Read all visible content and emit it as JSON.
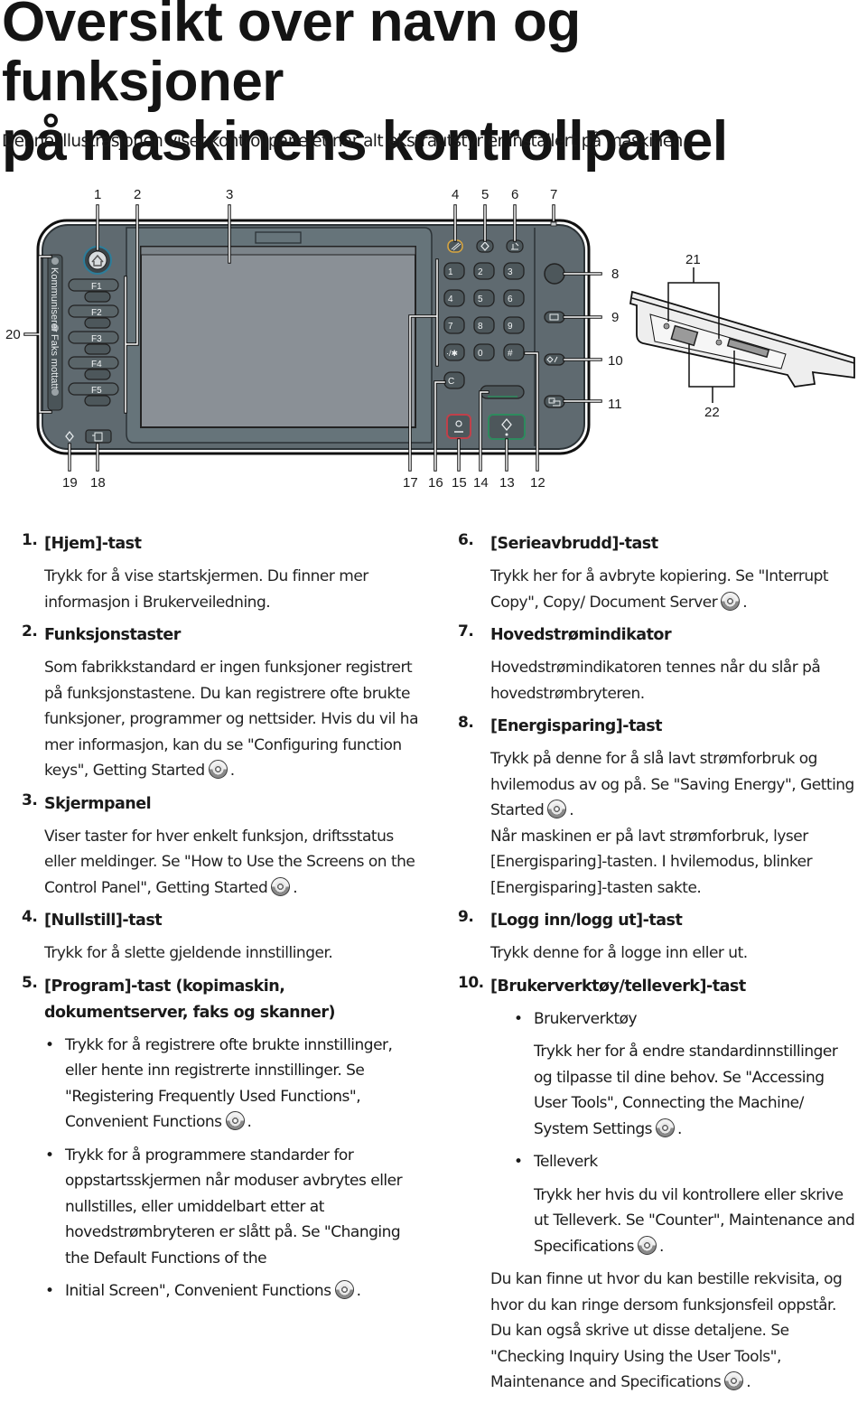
{
  "page": {
    "title_line1": "Oversikt over navn og funksjoner",
    "title_line2": "på maskinens kontrollpanel",
    "subtitle": "Denne illustrasjonen viser kontrollpanelet når alt ekstrautstyr er installert på maskinen."
  },
  "diagram": {
    "callouts_top": [
      "1",
      "2",
      "3",
      "4",
      "5",
      "6",
      "7"
    ],
    "callouts_right": [
      "8",
      "9",
      "10",
      "11"
    ],
    "callouts_bottom": [
      "19",
      "18",
      "17",
      "16",
      "15",
      "14",
      "13",
      "12"
    ],
    "callout_left": "20",
    "callout_side_top": "21",
    "callout_side_bottom": "22",
    "function_keys": [
      "F1",
      "F2",
      "F3",
      "F4",
      "F5"
    ],
    "indicator_labels": [
      "Kommuniserer",
      "Faks mottatt"
    ],
    "keypad": [
      "1",
      "2",
      "3",
      "4",
      "5",
      "6",
      "7",
      "8",
      "9",
      "·/✱",
      "0",
      "#"
    ],
    "clear_key": "C",
    "colors": {
      "panel": "#5f6a70",
      "panel_dark": "#3c4448",
      "screen": "#8a9096",
      "stop_red": "#c0404a",
      "start_green": "#2e8a5e",
      "reset_yellow": "#d9a640",
      "home_ring": "#2c7d9a"
    }
  },
  "left_column": [
    {
      "num": "1.",
      "heading": "[Hjem]-tast",
      "text": "Trykk for å vise startskjermen. Du finner mer informasjon i Brukerveiledning."
    },
    {
      "num": "2.",
      "heading": "Funksjonstaster",
      "text": "Som fabrikkstandard er ingen funksjoner registrert på funksjonstastene. Du kan registrere ofte brukte funksjoner, programmer og nettsider. Hvis du vil ha mer informasjon, kan du se \"Configuring function keys\", Getting Started",
      "cd_icon": true
    },
    {
      "num": "3.",
      "heading": "Skjermpanel",
      "text": "Viser taster for hver enkelt funksjon, driftsstatus eller meldinger. Se \"How to Use the Screens on the Control Panel\", Getting Started",
      "cd_icon": true
    },
    {
      "num": "4.",
      "heading": "[Nullstill]-tast",
      "text": "Trykk for å slette gjeldende innstillinger."
    },
    {
      "num": "5.",
      "heading": "[Program]-tast (kopimaskin, dokumentserver, faks og skanner)",
      "bullets": [
        "Trykk for å registrere ofte brukte innstillinger, eller hente inn registrerte innstillinger. Se \"Registering Frequently Used Functions\", Convenient Functions",
        "Trykk for å programmere standarder for oppstartsskjermen når moduser avbrytes eller nullstilles, eller umiddelbart etter at hovedstrømbryteren er slått på. Se \"Changing the Default Functions of the",
        "Initial Screen\", Convenient Functions"
      ]
    }
  ],
  "right_column": [
    {
      "num": "6.",
      "heading": "[Serieavbrudd]-tast",
      "text": "Trykk her for å avbryte kopiering. Se \"Interrupt Copy\", Copy/ Document Server",
      "cd_icon": true
    },
    {
      "num": "7.",
      "heading": "Hovedstrømindikator",
      "text": "Hovedstrømindikatoren tennes når du slår på hovedstrømbryteren."
    },
    {
      "num": "8.",
      "heading": "[Energisparing]-tast",
      "text": "Trykk på denne for å slå lavt strømforbruk og hvilemodus av og på. Se \"Saving Energy\", Getting Started",
      "cd_icon": true,
      "text2": "Når maskinen er på lavt strømforbruk, lyser [Energisparing]-tasten. I hvilemodus, blinker [Energisparing]-tasten sakte."
    },
    {
      "num": "9.",
      "heading": "[Logg inn/logg ut]-tast",
      "text": "Trykk denne for å logge inn eller ut."
    },
    {
      "num": "10.",
      "heading": "[Brukerverktøy/telleverk]-tast",
      "sub": [
        {
          "label": "Brukerverktøy",
          "text": "Trykk her for å endre standardinnstillinger og tilpasse til dine behov. Se \"Accessing User Tools\", Connecting the Machine/ System Settings"
        },
        {
          "label": "Telleverk",
          "text": "Trykk her hvis du vil kontrollere eller skrive ut Telleverk. Se \"Counter\", Maintenance and Specifications"
        }
      ],
      "footer": "Du kan finne ut hvor du kan bestille rekvisita, og hvor du kan ringe dersom funksjonsfeil oppstår. Du kan også skrive ut disse detaljene. Se \"Checking Inquiry Using the User Tools\", Maintenance and Specifications"
    }
  ],
  "bullet_glyph": "•",
  "period": "."
}
